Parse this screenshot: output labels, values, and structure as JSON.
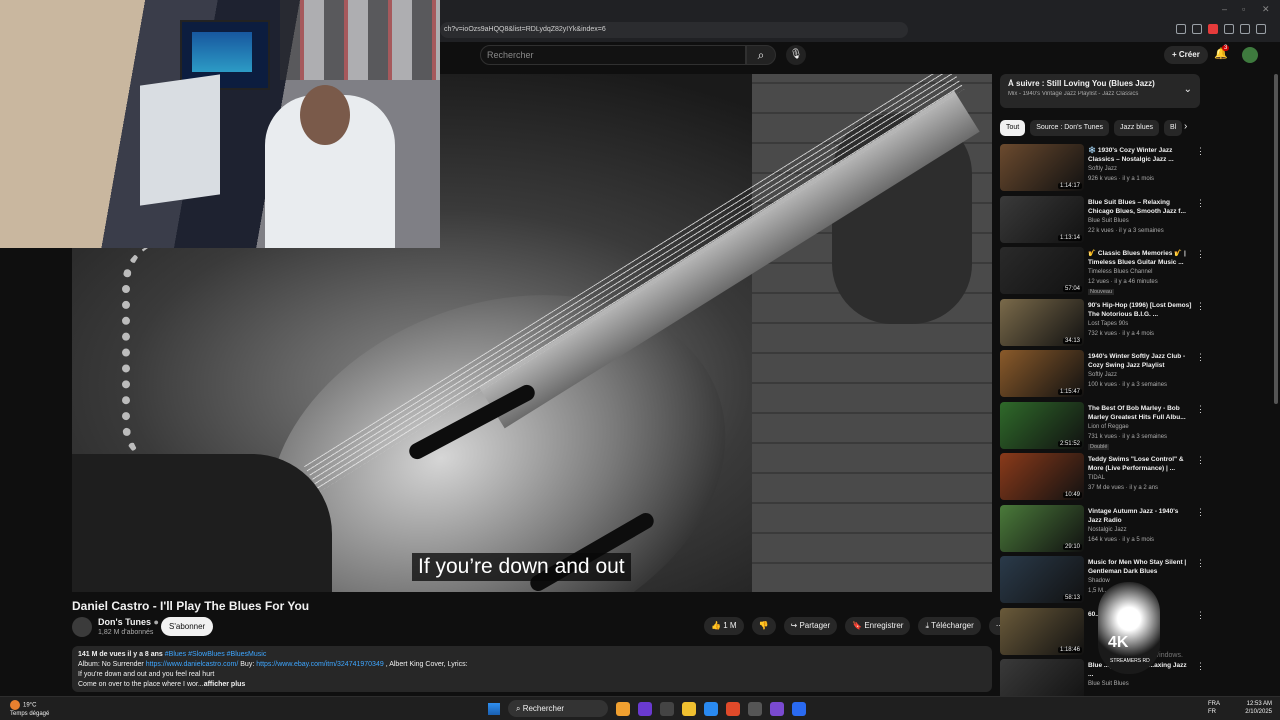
{
  "browser": {
    "url": "ch?v=ioOzs9aHQQ8&list=RDLydqZ82yIYk&index=6"
  },
  "header": {
    "search_placeholder": "Rechercher",
    "create_label": "Créer",
    "notifications": "3"
  },
  "player": {
    "subtitle": "If you’re down and out"
  },
  "video": {
    "title": "Daniel Castro - I'll Play The Blues For You",
    "channel": "Don's Tunes",
    "subscribers": "1,82 M d'abonnés",
    "subscribe_label": "S'abonner",
    "likes": "1 M",
    "share_label": "Partager",
    "save_label": "Enregistrer",
    "download_label": "Télécharger",
    "desc_stats": "141 M de vues  il y a 8 ans",
    "desc_tags": "#Blues #SlowBlues #BluesMusic",
    "desc_album": "Album: No Surrender",
    "desc_link1": "https://www.danielcastro.com/",
    "desc_buy": "Buy:",
    "desc_link2": "https://www.ebay.com/itm/324741970349",
    "desc_cover": ", Albert King Cover,  Lyrics:",
    "desc_line2": "If you're down and out and you feel real hurt",
    "desc_line3": "Come on over to the place where I wor...",
    "desc_more": "afficher plus"
  },
  "playlist": {
    "title": "À suivre : Still Loving You (Blues Jazz)",
    "subtitle": "Mix - 1940's Vintage Jazz Playlist - Jazz Classics"
  },
  "chips": [
    "Tout",
    "Source : Don's Tunes",
    "Jazz blues",
    "Bl"
  ],
  "recommendations": [
    {
      "title": "❄️ 1930's Cozy Winter Jazz Classics – Nostalgic Jazz ...",
      "channel": "Softly Jazz",
      "meta": "926 k vues · il y a 1 mois",
      "duration": "1:14:17",
      "badge": "",
      "color": "#6b4a2e"
    },
    {
      "title": "Blue Suit Blues – Relaxing Chicago Blues, Smooth Jazz f...",
      "channel": "Blue Suit Blues",
      "meta": "22 k vues · il y a 3 semaines",
      "duration": "1:13:14",
      "badge": "",
      "color": "#3a3a3a"
    },
    {
      "title": "🎷 Classic Blues Memories 🎷 | Timeless Blues Guitar Music ...",
      "channel": "Timeless Blues Channel",
      "meta": "12 vues · il y a 46 minutes",
      "duration": "57:04",
      "badge": "Nouveau",
      "color": "#2a2a2a"
    },
    {
      "title": "90's Hip-Hop (1996) [Lost Demos] The Notorious B.I.G. ...",
      "channel": "Lost Tapes 90s",
      "meta": "732 k vues · il y a 4 mois",
      "duration": "34:13",
      "badge": "",
      "color": "#7a6a4a"
    },
    {
      "title": "1940's Winter Softly Jazz Club - Cozy Swing Jazz Playlist",
      "channel": "Softly Jazz",
      "meta": "100 k vues · il y a 3 semaines",
      "duration": "1:15:47",
      "badge": "",
      "color": "#8a5a2a"
    },
    {
      "title": "The Best Of Bob Marley - Bob Marley Greatest Hits Full Albu...",
      "channel": "Lion of Reggae",
      "meta": "731 k vues · il y a 3 semaines",
      "duration": "2:51:52",
      "badge": "Doublé",
      "color": "#2f6a2a"
    },
    {
      "title": "Teddy Swims \"Lose Control\" & More (Live Performance) | ...",
      "channel": "TIDAL",
      "meta": "37 M de vues · il y a 2 ans",
      "duration": "10:49",
      "badge": "",
      "color": "#8a3a1a"
    },
    {
      "title": "Vintage Autumn Jazz - 1940's Jazz Radio",
      "channel": "Nostalgic Jazz",
      "meta": "164 k vues · il y a 5 mois",
      "duration": "29:10",
      "badge": "",
      "color": "#4a7a3a"
    },
    {
      "title": "Music for Men Who Stay Silent | Gentleman Dark Blues",
      "channel": "Shadow",
      "meta": "1,5 M...",
      "duration": "58:13",
      "badge": "",
      "color": "#2a3a4a"
    },
    {
      "title": "60...sed ...Coo...",
      "channel": "",
      "meta": "",
      "duration": "1:18:46",
      "badge": "",
      "color": "#6a5a3a"
    },
    {
      "title": "Blue ...ght Chicago ...axing Jazz ...",
      "channel": "Blue Suit Blues",
      "meta": "",
      "duration": "",
      "badge": "",
      "color": "#3a3a3a"
    }
  ],
  "watermark": {
    "text": "4K",
    "sub": "STREAMERS RD"
  },
  "activate_text": "activer Windows.",
  "taskbar": {
    "temp": "19°C",
    "weather": "Temps dégagé",
    "search": "Rechercher",
    "lang1": "FRA",
    "lang2": "FR",
    "time": "12:53 AM",
    "date": "2/10/2025"
  }
}
